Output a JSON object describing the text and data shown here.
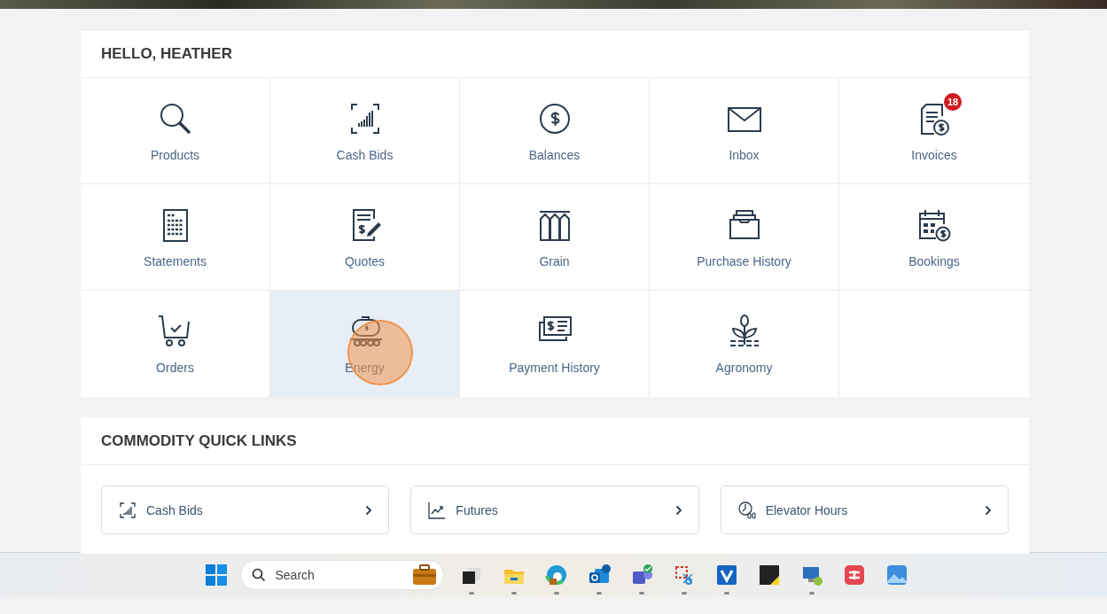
{
  "greeting": {
    "title": "HELLO, HEATHER"
  },
  "tiles": [
    {
      "label": "Products",
      "selected": false
    },
    {
      "label": "Cash Bids",
      "selected": false
    },
    {
      "label": "Balances",
      "selected": false
    },
    {
      "label": "Inbox",
      "selected": false
    },
    {
      "label": "Invoices",
      "selected": false,
      "badge": "18"
    },
    {
      "label": "Statements",
      "selected": false
    },
    {
      "label": "Quotes",
      "selected": false
    },
    {
      "label": "Grain",
      "selected": false
    },
    {
      "label": "Purchase History",
      "selected": false
    },
    {
      "label": "Bookings",
      "selected": false
    },
    {
      "label": "Orders",
      "selected": false
    },
    {
      "label": "Energy",
      "selected": true
    },
    {
      "label": "Payment History",
      "selected": false
    },
    {
      "label": "Agronomy",
      "selected": false
    }
  ],
  "quick_links": {
    "title": "COMMODITY QUICK LINKS",
    "links": [
      {
        "label": "Cash Bids"
      },
      {
        "label": "Futures"
      },
      {
        "label": "Elevator Hours"
      }
    ]
  },
  "taskbar": {
    "search": {
      "placeholder": "Search"
    },
    "apps": [
      {
        "running": true
      },
      {
        "running": true
      },
      {
        "running": true
      },
      {
        "running": true
      },
      {
        "running": true
      },
      {
        "running": true
      },
      {
        "running": true
      },
      {
        "running": false
      },
      {
        "running": true
      },
      {
        "running": false
      },
      {
        "running": false
      }
    ]
  }
}
